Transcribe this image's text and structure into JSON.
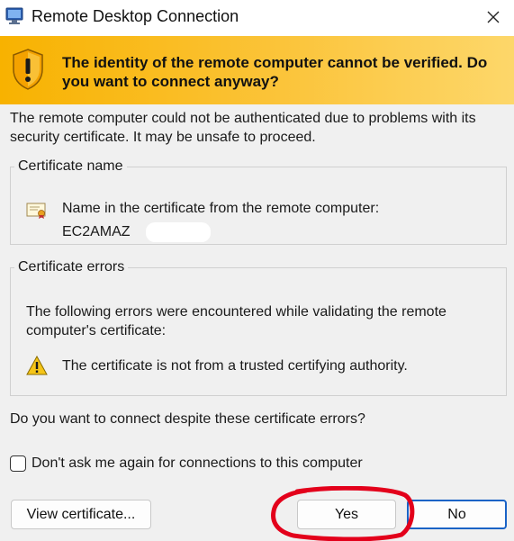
{
  "window": {
    "title": "Remote Desktop Connection",
    "close_icon": "close-icon"
  },
  "banner": {
    "message": "The identity of the remote computer cannot be verified. Do you want to connect anyway?",
    "icon": "warning-shield-icon",
    "color": "#f8b200"
  },
  "intro": "The remote computer could not be authenticated due to problems with its security certificate. It may be unsafe to proceed.",
  "certificate_name": {
    "legend": "Certificate name",
    "label": "Name in the certificate from the remote computer:",
    "value": "EC2AMAZ",
    "icon": "certificate-icon"
  },
  "certificate_errors": {
    "legend": "Certificate errors",
    "intro": "The following errors were encountered while validating the remote computer's certificate:",
    "items": [
      {
        "icon": "warning-icon",
        "text": "The certificate is not from a trusted certifying authority."
      }
    ]
  },
  "question": "Do you want to connect despite these certificate errors?",
  "dont_ask": {
    "label": "Don't ask me again for connections to this computer",
    "checked": false
  },
  "buttons": {
    "view_certificate": "View certificate...",
    "yes": "Yes",
    "no": "No"
  },
  "colors": {
    "default_button_border": "#1a63c6",
    "annotation_circle": "#e3001b"
  }
}
